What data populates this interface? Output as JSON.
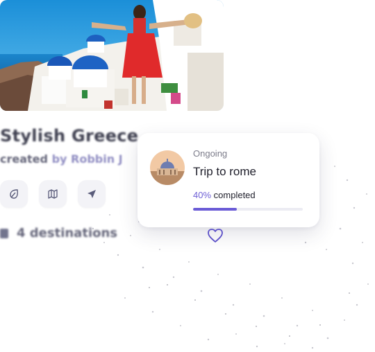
{
  "travel_card": {
    "title": "Stylish Greece",
    "subtitle_prefix": "created",
    "subtitle_author": "by Robbin J",
    "meta_text": "4 destinations",
    "actions": [
      {
        "icon": "leaf-icon"
      },
      {
        "icon": "map-icon"
      },
      {
        "icon": "navigation-arrow-icon"
      }
    ]
  },
  "trip_progress": {
    "status": "Ongoing",
    "name": "Trip to rome",
    "percent_label": "40%",
    "completed_label": "completed",
    "progress": 0.4
  },
  "colors": {
    "accent": "#6a5bd6",
    "heart": "#5b4fc8",
    "track": "#ececf3"
  }
}
